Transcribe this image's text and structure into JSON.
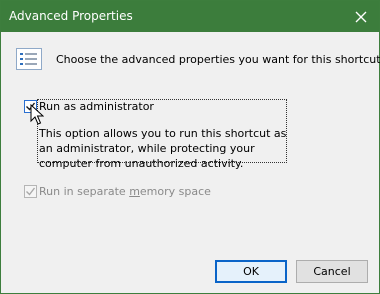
{
  "dialog": {
    "title": "Advanced Properties",
    "close_icon": "close-icon",
    "header_text": "Choose the advanced properties you want for this shortcut.",
    "header_icon": "checklist-icon"
  },
  "options": {
    "admin": {
      "label": "Run as administrator",
      "checked": true,
      "description": "This option allows you to run this shortcut as an administrator, while protecting your computer from unauthorized activity."
    },
    "memory": {
      "label_before": "Run in separate ",
      "label_mnemonic": "m",
      "label_after": "emory space",
      "checked": true,
      "disabled": true
    }
  },
  "buttons": {
    "ok_label": "OK",
    "cancel_label": "Cancel"
  },
  "colors": {
    "titlebar": "#3c7d3c",
    "accent": "#0a64c8",
    "disabled_text": "#8a8a8a"
  }
}
